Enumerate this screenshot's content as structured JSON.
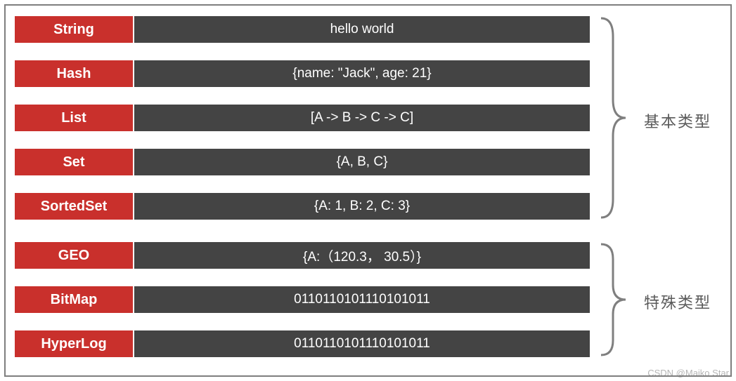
{
  "rows": [
    {
      "type": "String",
      "value": "hello world"
    },
    {
      "type": "Hash",
      "value": "{name: \"Jack\", age: 21}"
    },
    {
      "type": "List",
      "value": "[A -> B -> C -> C]"
    },
    {
      "type": "Set",
      "value": "{A, B, C}"
    },
    {
      "type": "SortedSet",
      "value": "{A: 1, B: 2, C: 3}"
    },
    {
      "type": "GEO",
      "value": "{A:（120.3， 30.5）}"
    },
    {
      "type": "BitMap",
      "value": "0110110101110101011"
    },
    {
      "type": "HyperLog",
      "value": "0110110101110101011"
    }
  ],
  "groups": {
    "basic": "基本类型",
    "special": "特殊类型"
  },
  "watermark": "CSDN @Maiko Star",
  "colors": {
    "type_bg": "#c9302c",
    "value_bg": "#444444",
    "border": "#7f7f7f"
  }
}
